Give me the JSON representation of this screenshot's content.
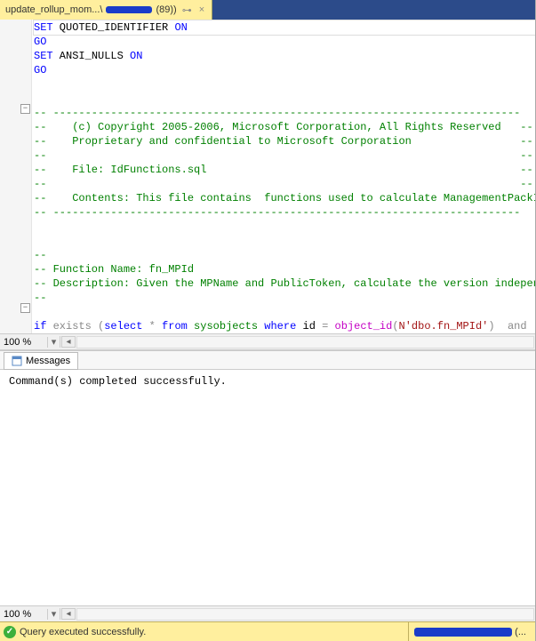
{
  "tab": {
    "label_prefix": "update_rollup_mom...\\",
    "label_suffix": " (89))",
    "pin_glyph": "⊶",
    "close_glyph": "×"
  },
  "editor": {
    "zoom": "100 %",
    "fold_glyph": "−",
    "lines": {
      "l1_a": "SET",
      "l1_b": " QUOTED_IDENTIFIER ",
      "l1_c": "ON",
      "l2": "GO",
      "l3_a": "SET",
      "l3_b": " ANSI_NULLS ",
      "l3_c": "ON",
      "l4": "GO",
      "c_dash": "-- -------------------------------------------------------------------------",
      "c_cpy": "--    (c) Copyright 2005-2006, Microsoft Corporation, All Rights Reserved   --",
      "c_prop": "--    Proprietary and confidential to Microsoft Corporation                 --",
      "c_blank": "--                                                                          --",
      "c_file": "--    File: IdFunctions.sql                                                 --",
      "c_cont": "--    Contents: This file contains  functions used to calculate ManagementPackId",
      "c_fn": "-- Function Name: fn_MPId",
      "c_desc": "-- Description: Given the MPName and PublicToken, calculate the version independ",
      "c_only": "--",
      "if_a": "if",
      "if_b": " exists ",
      "if_c": "(",
      "if_d": "select",
      "if_e": " * ",
      "if_f": "from",
      "if_g": " sysobjects ",
      "if_h": "where",
      "if_i": " id ",
      "if_j": "=",
      "if_k": " object_id",
      "if_l": "(",
      "if_m": "N'dbo.fn_MPId'",
      "if_n": ")",
      "if_o": "  and  OB"
    }
  },
  "messages": {
    "tab_label": "Messages",
    "text": "Command(s) completed successfully.",
    "zoom": "100 %"
  },
  "status": {
    "text": "Query executed successfully.",
    "suffix": " (..."
  }
}
